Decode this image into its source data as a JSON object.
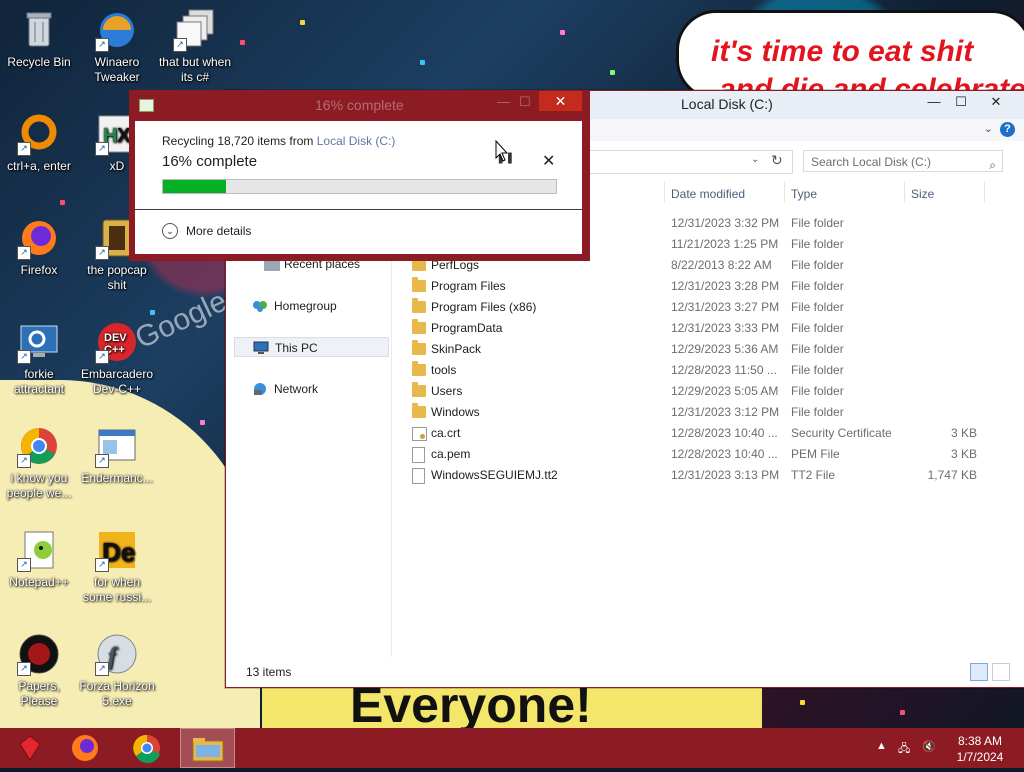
{
  "desktop": {
    "icons": [
      {
        "label": "Recycle Bin",
        "icon": "recycle-bin-icon"
      },
      {
        "label": "Winaero Tweaker",
        "icon": "winaero-icon"
      },
      {
        "label": "that but when its c#",
        "icon": "stack-windows-icon"
      },
      {
        "label": "ctrl+a, enter",
        "icon": "orange-ring-icon"
      },
      {
        "label": "xD",
        "icon": "hx-icon"
      },
      {
        "label": "Firefox",
        "icon": "firefox-icon"
      },
      {
        "label": "the popcap shit",
        "icon": "popcap-icon"
      },
      {
        "label": "forkie attractant",
        "icon": "gear-monitor-icon"
      },
      {
        "label": "Embarcadero Dev-C++",
        "icon": "devcpp-icon"
      },
      {
        "label": "i know you people we...",
        "icon": "chrome-icon"
      },
      {
        "label": "Endermanc...",
        "icon": "window-app-icon"
      },
      {
        "label": "Notepad++",
        "icon": "notepad-plus-icon"
      },
      {
        "label": "for when some russi...",
        "icon": "de-icon"
      },
      {
        "label": "Papers, Please",
        "icon": "papers-please-icon"
      },
      {
        "label": "Forza Horizon 5.exe",
        "icon": "flash-icon"
      }
    ],
    "wallpaper_texts": {
      "speech_line1": "it's time to eat shit",
      "speech_line2": "and die and celebrate",
      "banner": "Everyone!",
      "sign": "Google play"
    }
  },
  "explorer": {
    "title": "Local Disk (C:)",
    "search_placeholder": "Search Local Disk (C:)",
    "nav": {
      "recent": "Recent places",
      "homegroup": "Homegroup",
      "this_pc": "This PC",
      "network": "Network"
    },
    "columns": {
      "date": "Date modified",
      "type": "Type",
      "size": "Size"
    },
    "rows": [
      {
        "name": "",
        "date": "12/31/2023 3:32 PM",
        "type": "File folder",
        "size": "",
        "kind": "folder"
      },
      {
        "name": "",
        "date": "11/21/2023 1:25 PM",
        "type": "File folder",
        "size": "",
        "kind": "folder"
      },
      {
        "name": "PerfLogs",
        "date": "8/22/2013 8:22 AM",
        "type": "File folder",
        "size": "",
        "kind": "folder"
      },
      {
        "name": "Program Files",
        "date": "12/31/2023 3:28 PM",
        "type": "File folder",
        "size": "",
        "kind": "folder"
      },
      {
        "name": "Program Files (x86)",
        "date": "12/31/2023 3:27 PM",
        "type": "File folder",
        "size": "",
        "kind": "folder"
      },
      {
        "name": "ProgramData",
        "date": "12/31/2023 3:33 PM",
        "type": "File folder",
        "size": "",
        "kind": "folder"
      },
      {
        "name": "SkinPack",
        "date": "12/29/2023 5:36 AM",
        "type": "File folder",
        "size": "",
        "kind": "folder"
      },
      {
        "name": "tools",
        "date": "12/28/2023 11:50 ...",
        "type": "File folder",
        "size": "",
        "kind": "folder"
      },
      {
        "name": "Users",
        "date": "12/29/2023 5:05 AM",
        "type": "File folder",
        "size": "",
        "kind": "folder"
      },
      {
        "name": "Windows",
        "date": "12/31/2023 3:12 PM",
        "type": "File folder",
        "size": "",
        "kind": "folder"
      },
      {
        "name": "ca.crt",
        "date": "12/28/2023 10:40 ...",
        "type": "Security Certificate",
        "size": "3 KB",
        "kind": "cert"
      },
      {
        "name": "ca.pem",
        "date": "12/28/2023 10:40 ...",
        "type": "PEM File",
        "size": "3 KB",
        "kind": "doc"
      },
      {
        "name": "WindowsSEGUIEMJ.tt2",
        "date": "12/31/2023 3:13 PM",
        "type": "TT2 File",
        "size": "1,747 KB",
        "kind": "doc"
      }
    ],
    "status": "13 items"
  },
  "dialog": {
    "title": "16% complete",
    "line_prefix": "Recycling 18,720 items from ",
    "line_source": "Local Disk (C:)",
    "percent_text": "16% complete",
    "progress": 0.16,
    "more_details": "More details"
  },
  "taskbar": {
    "items": [
      "ruby-icon",
      "firefox-icon",
      "chrome-icon",
      "file-explorer-icon"
    ],
    "time": "8:38 AM",
    "date": "1/7/2024"
  },
  "colors": {
    "accent": "#8c1b24",
    "progress": "#06b025",
    "close_red": "#c42b1c"
  }
}
